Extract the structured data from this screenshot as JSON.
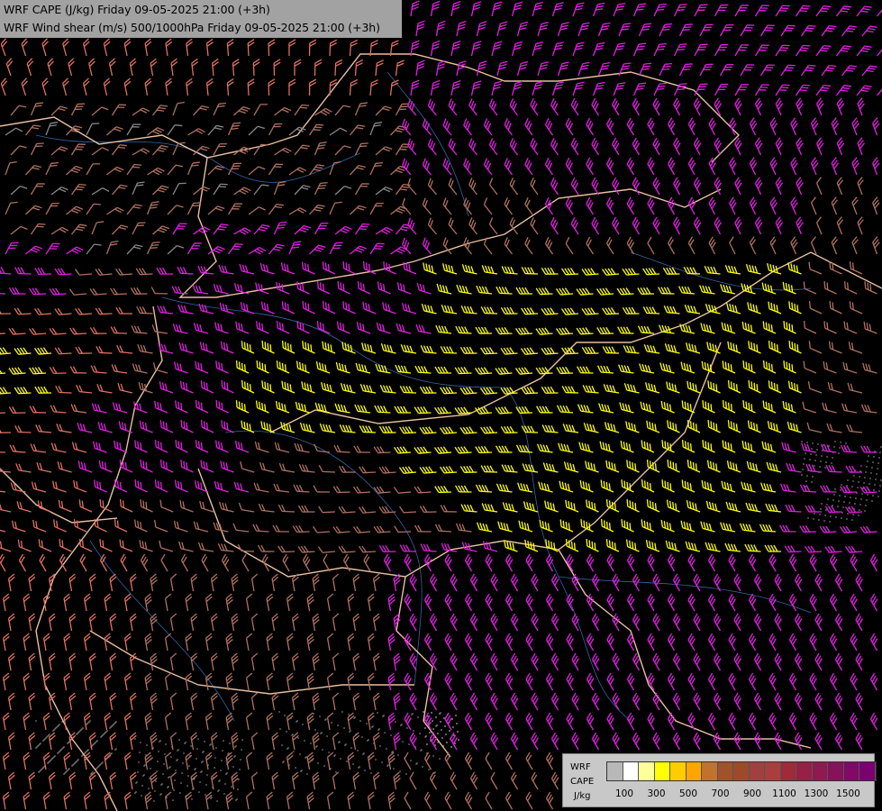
{
  "header": {
    "title_line_1": "WRF CAPE (J/kg) Friday 09-05-2025 21:00 (+3h)",
    "title_line_2": "WRF Wind shear (m/s) 500/1000hPa Friday 09-05-2025 21:00 (+3h)"
  },
  "legend": {
    "label_1": "WRF",
    "label_2": "CAPE",
    "label_3": "J/kg",
    "colors": [
      "#b8b8b8",
      "#ffffff",
      "#ffff99",
      "#ffff00",
      "#ffcc00",
      "#ffa500",
      "#c0722e",
      "#a0522d",
      "#9c4a2a",
      "#a04040",
      "#a83e3e",
      "#9e2a3a",
      "#962046",
      "#8e1a50",
      "#86125a",
      "#800a66",
      "#7a0270"
    ],
    "ticks": [
      "100",
      "300",
      "500",
      "700",
      "900",
      "1100",
      "1300",
      "1500"
    ]
  },
  "map": {
    "barb_colors": {
      "weak": "#888888",
      "moderate": "#b07060",
      "salmon": "#e07060",
      "pink": "#f08878",
      "magenta": "#e020e0",
      "yellow": "#ffff00"
    },
    "border_color": "#e8c0a0",
    "river_color": "#4080d0"
  }
}
